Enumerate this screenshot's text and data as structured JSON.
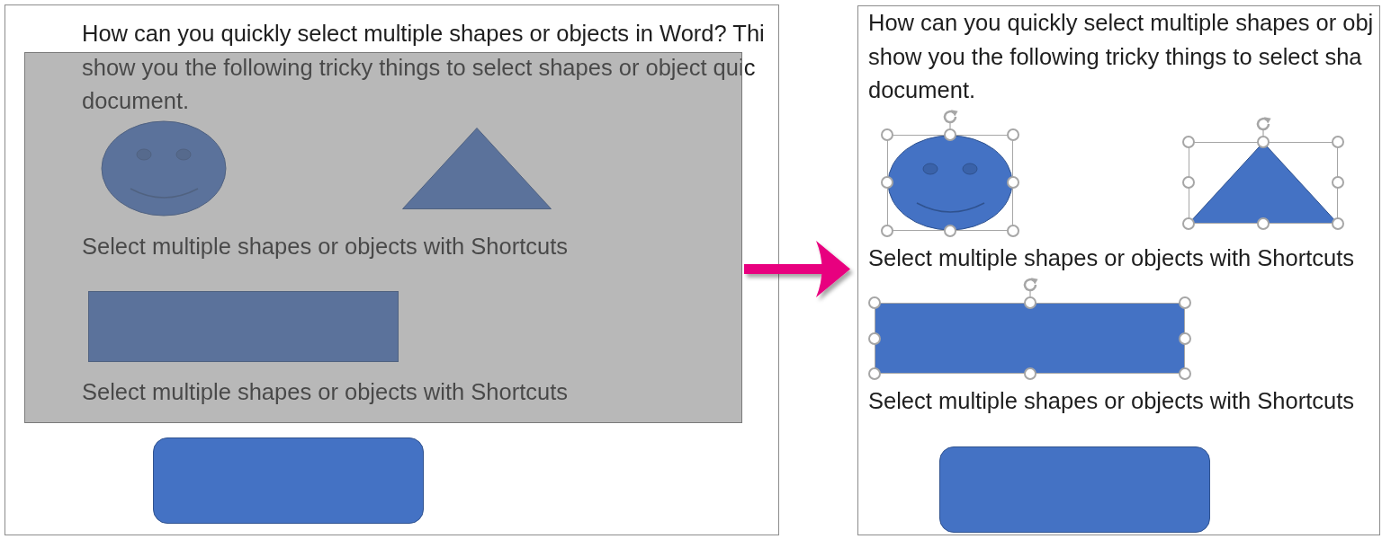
{
  "panels": [
    {
      "marquee": true,
      "blocks": [
        {
          "kind": "paragraph",
          "lines": [
            "How can you quickly select multiple shapes or objects in Word? Thi",
            "show you the following tricky things to select shapes or object quic",
            "document."
          ]
        },
        {
          "kind": "shapes",
          "shapes": [
            {
              "kind": "smiley",
              "selected": false
            },
            {
              "kind": "triangle",
              "selected": false
            }
          ]
        },
        {
          "kind": "caption",
          "text": "Select multiple shapes or objects with Shortcuts"
        },
        {
          "kind": "shapes",
          "shapes": [
            {
              "kind": "rectangle",
              "selected": false
            }
          ]
        },
        {
          "kind": "caption",
          "text": "Select multiple shapes or objects with Shortcuts"
        },
        {
          "kind": "shapes",
          "shapes": [
            {
              "kind": "rounded_rectangle",
              "selected": false
            }
          ]
        }
      ]
    },
    {
      "marquee": false,
      "blocks": [
        {
          "kind": "paragraph",
          "lines": [
            "How can you quickly select multiple shapes or obj",
            "show you the following tricky things to select sha",
            "document."
          ]
        },
        {
          "kind": "shapes",
          "shapes": [
            {
              "kind": "smiley",
              "selected": true
            },
            {
              "kind": "triangle",
              "selected": true
            }
          ]
        },
        {
          "kind": "caption",
          "text": "Select multiple shapes or objects with Shortcuts"
        },
        {
          "kind": "shapes",
          "shapes": [
            {
              "kind": "rectangle",
              "selected": true
            }
          ]
        },
        {
          "kind": "caption",
          "text": "Select multiple shapes or objects with Shortcuts"
        },
        {
          "kind": "shapes",
          "shapes": [
            {
              "kind": "rounded_rectangle",
              "selected": false
            }
          ]
        }
      ]
    }
  ]
}
